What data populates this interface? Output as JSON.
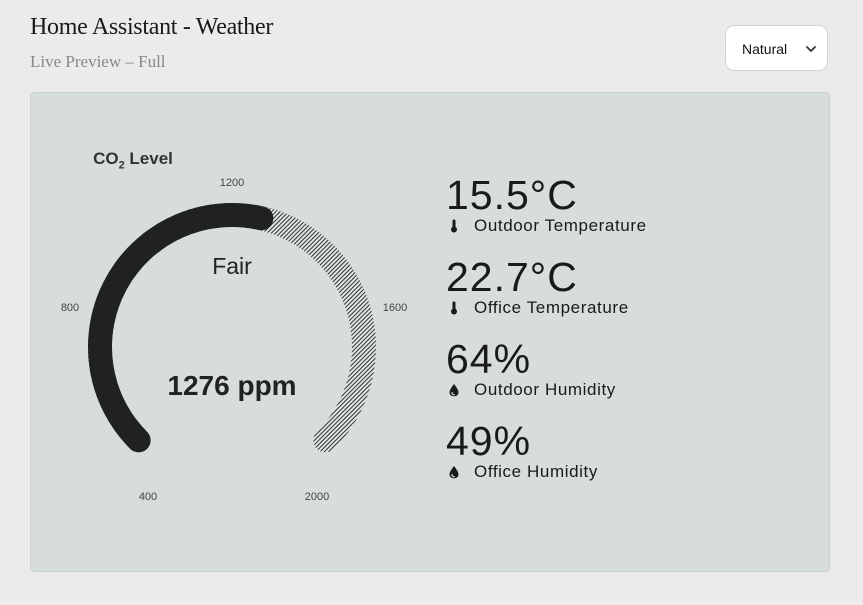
{
  "header": {
    "title": "Home Assistant - Weather",
    "subtitle": "Live Preview – Full"
  },
  "theme_select": {
    "value": "Natural",
    "icon": "chevron-down-icon"
  },
  "gauge": {
    "title_main": "CO",
    "title_sub": "2",
    "title_rest": " Level",
    "status": "Fair",
    "value_text": "1276 ppm",
    "value": 1276,
    "min": 400,
    "max": 2000,
    "ticks": [
      "400",
      "800",
      "1200",
      "1600",
      "2000"
    ],
    "filled_color": "#202222",
    "remaining_color": "#1c1c1c"
  },
  "readings": [
    {
      "value": "15.5°C",
      "label": "Outdoor Temperature",
      "icon": "thermometer-icon"
    },
    {
      "value": "22.7°C",
      "label": "Office Temperature",
      "icon": "thermometer-icon"
    },
    {
      "value": "64%",
      "label": "Outdoor Humidity",
      "icon": "droplet-icon"
    },
    {
      "value": "49%",
      "label": "Office Humidity",
      "icon": "droplet-icon"
    }
  ],
  "colors": {
    "background": "#ebebeb",
    "panel": "#d7dddd",
    "text": "#1a1a1a"
  }
}
